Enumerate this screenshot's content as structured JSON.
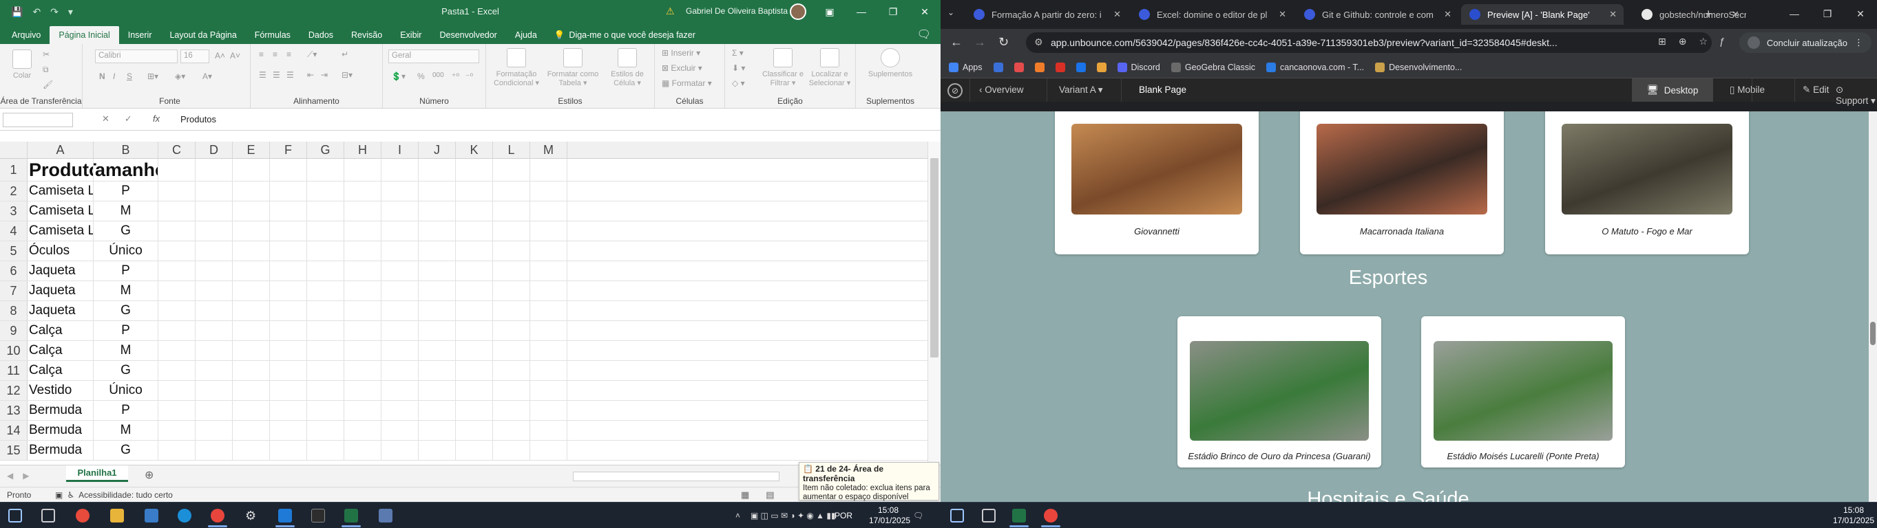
{
  "excel": {
    "quick_access": [
      "💾",
      "↶",
      "↷",
      "▾"
    ],
    "doc_title": "Pasta1 - Excel",
    "user": "Gabriel De Oliveira Baptista",
    "tabs": [
      "Arquivo",
      "Página Inicial",
      "Inserir",
      "Layout da Página",
      "Fórmulas",
      "Dados",
      "Revisão",
      "Exibir",
      "Desenvolvedor",
      "Ajuda"
    ],
    "active_tab": "Página Inicial",
    "tell_me": "Diga-me o que você deseja fazer",
    "ribbon": {
      "clipboard": {
        "label": "Área de Transferência",
        "paste": "Colar"
      },
      "font": {
        "label": "Fonte",
        "font_name": "Calibri",
        "font_size": "16",
        "bold": "N",
        "italic": "I",
        "underline": "S"
      },
      "alignment": {
        "label": "Alinhamento"
      },
      "number": {
        "label": "Número",
        "format": "Geral",
        "percent": "%",
        "thousands": "000"
      },
      "styles": {
        "label": "Estilos",
        "buttons": [
          "Formatação Condicional ▾",
          "Formatar como Tabela ▾",
          "Estilos de Célula ▾"
        ]
      },
      "cells": {
        "label": "Células",
        "insert": "Inserir",
        "delete": "Excluir",
        "format": "Formatar"
      },
      "editing": {
        "label": "Edição",
        "buttons": [
          "Classificar e Filtrar ▾",
          "Localizar e Selecionar ▾"
        ]
      },
      "addins": {
        "label": "Suplementos",
        "button": "Suplementos"
      }
    },
    "formula_bar": {
      "name_box": "",
      "fx": "fx",
      "value": "Produtos"
    },
    "columns": [
      "A",
      "B",
      "C",
      "D",
      "E",
      "F",
      "G",
      "H",
      "I",
      "J",
      "K",
      "L",
      "M"
    ],
    "rows": [
      {
        "n": "1",
        "a": "Produtos",
        "b": "Tamanho"
      },
      {
        "n": "2",
        "a": "Camiseta Lisa",
        "b": "P"
      },
      {
        "n": "3",
        "a": "Camiseta Lisa",
        "b": "M"
      },
      {
        "n": "4",
        "a": "Camiseta Lisa",
        "b": "G"
      },
      {
        "n": "5",
        "a": "Óculos",
        "b": "Único"
      },
      {
        "n": "6",
        "a": "Jaqueta",
        "b": "P"
      },
      {
        "n": "7",
        "a": "Jaqueta",
        "b": "M"
      },
      {
        "n": "8",
        "a": "Jaqueta",
        "b": "G"
      },
      {
        "n": "9",
        "a": "Calça",
        "b": "P"
      },
      {
        "n": "10",
        "a": "Calça",
        "b": "M"
      },
      {
        "n": "11",
        "a": "Calça",
        "b": "G"
      },
      {
        "n": "12",
        "a": "Vestido",
        "b": "Único"
      },
      {
        "n": "13",
        "a": "Bermuda",
        "b": "P"
      },
      {
        "n": "14",
        "a": "Bermuda",
        "b": "M"
      },
      {
        "n": "15",
        "a": "Bermuda",
        "b": "G"
      }
    ],
    "sheet_tab": "Planilha1",
    "status": {
      "ready": "Pronto",
      "accessibility": "Acessibilidade: tudo certo"
    },
    "clipboard_toast": {
      "title": "21 de 24- Área de transferência",
      "body": "Item não coletado: exclua itens para aumentar o espaço disponível"
    }
  },
  "browser": {
    "tabs": [
      {
        "title": "Formação A partir do zero: i",
        "color": "#3b5bdb"
      },
      {
        "title": "Excel: domine o editor de pl",
        "color": "#3b5bdb"
      },
      {
        "title": "Git e Github: controle e com",
        "color": "#3b5bdb"
      },
      {
        "title": "Preview [A] - 'Blank Page'",
        "color": "#2b4ecf"
      },
      {
        "title": "gobstech/numeroSecretoAl",
        "color": "#e8e8e8"
      }
    ],
    "active_tab_index": 3,
    "url": "app.unbounce.com/5639042/pages/836f426e-cc4c-4051-a39e-711359301eb3/preview?variant_id=323584045#deskt...",
    "update_button": "Concluir atualização",
    "bookmarks": [
      {
        "label": "Apps",
        "color": "#4285f4"
      },
      {
        "label": "",
        "color": "#3a6fd8"
      },
      {
        "label": "",
        "color": "#e44b4b"
      },
      {
        "label": "",
        "color": "#f07c2a"
      },
      {
        "label": "",
        "color": "#d93025"
      },
      {
        "label": "",
        "color": "#1a73e8"
      },
      {
        "label": "",
        "color": "#e8a33a"
      },
      {
        "label": "Discord",
        "color": "#5865f2"
      },
      {
        "label": "GeoGebra Classic",
        "color": "#6a6a6a"
      },
      {
        "label": "cancaonova.com - T...",
        "color": "#2a7be4"
      },
      {
        "label": "Desenvolvimento...",
        "color": "#caa04a"
      }
    ],
    "unbounce_bar": {
      "overview": "Overview",
      "variant": "Variant A",
      "page": "Blank Page",
      "desktop": "Desktop",
      "mobile": "Mobile",
      "edit": "Edit",
      "support": "Support"
    },
    "page": {
      "restaurants": [
        {
          "caption": "Giovannetti",
          "color1": "#7a4a2a",
          "color2": "#c58a52"
        },
        {
          "caption": "Macarronada Italiana",
          "color1": "#3a2a24",
          "color2": "#b86a4a"
        },
        {
          "caption": "O Matuto - Fogo e Mar",
          "color1": "#3e3a30",
          "color2": "#7d7a66"
        }
      ],
      "section_sports": "Esportes",
      "stadiums": [
        {
          "caption": "Estádio Brinco de Ouro da Princesa (Guarani)",
          "color1": "#3a7a3a",
          "color2": "#8a8f86"
        },
        {
          "caption": "Estádio Moisés Lucarelli (Ponte Preta)",
          "color1": "#4a7d3e",
          "color2": "#9aa09a"
        }
      ],
      "section_health": "Hospitais e Saúde"
    }
  },
  "taskbar_left": {
    "lang": "POR",
    "time": "15:08",
    "date": "17/01/2025"
  },
  "taskbar_right": {
    "time": "15:08",
    "date": "17/01/2025"
  }
}
